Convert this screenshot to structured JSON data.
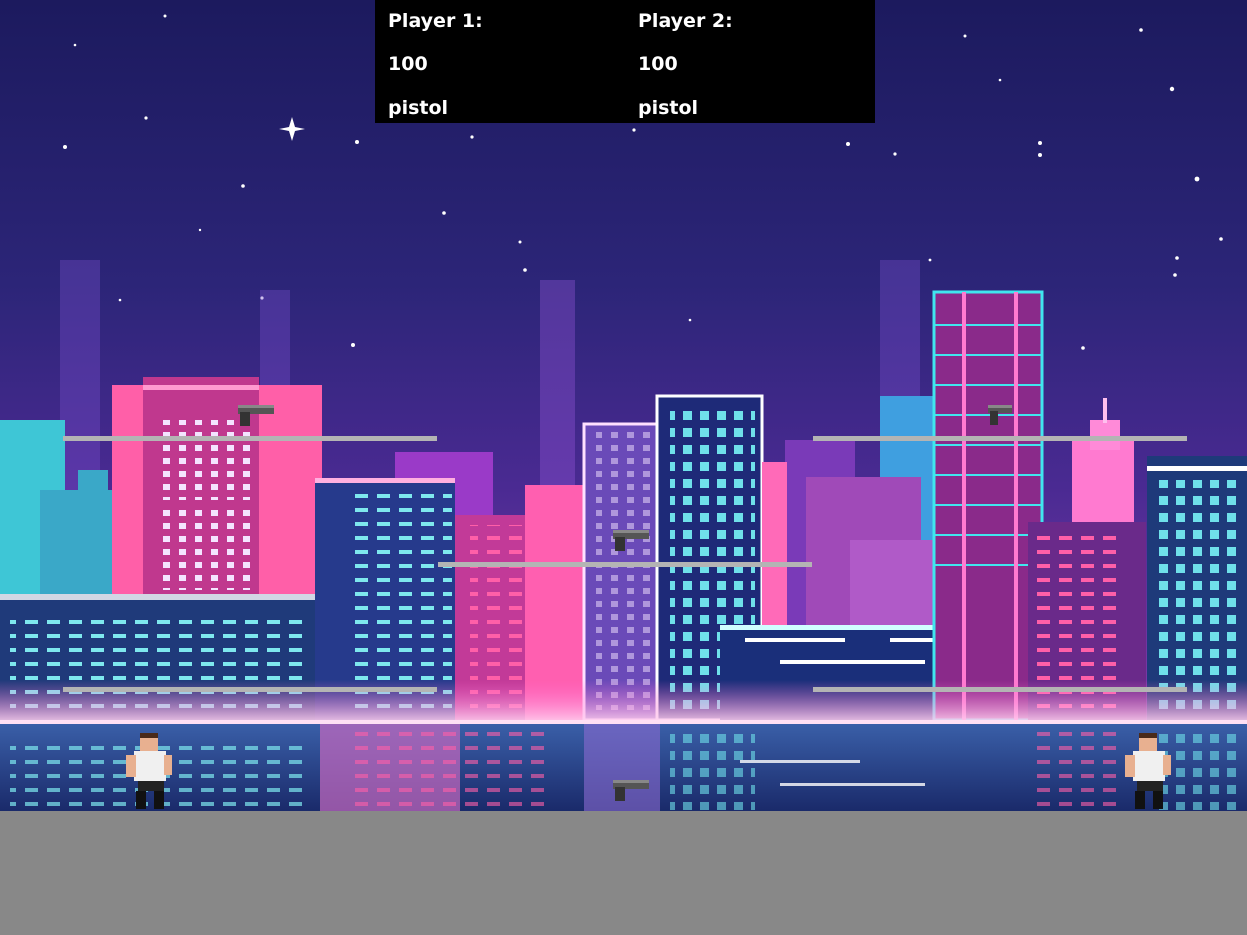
{
  "hud": {
    "player1": {
      "label": "Player 1:",
      "health": "100",
      "weapon": "pistol"
    },
    "player2": {
      "label": "Player 2:",
      "health": "100",
      "weapon": "pistol"
    }
  },
  "colors": {
    "sky_top": "#1c1a5e",
    "sky_mid": "#3a2a8a",
    "sky_low": "#6a2fa0",
    "platform": "#b4b4b4",
    "ground": "#888888",
    "hud_bg": "#000000",
    "hud_text": "#ffffff"
  },
  "scene": {
    "platforms": 5,
    "weapon_pickups": [
      "pistol-icon",
      "pistol-icon",
      "pistol-icon",
      "pistol-icon"
    ],
    "players": [
      "player-1-sprite",
      "player-2-sprite"
    ]
  }
}
